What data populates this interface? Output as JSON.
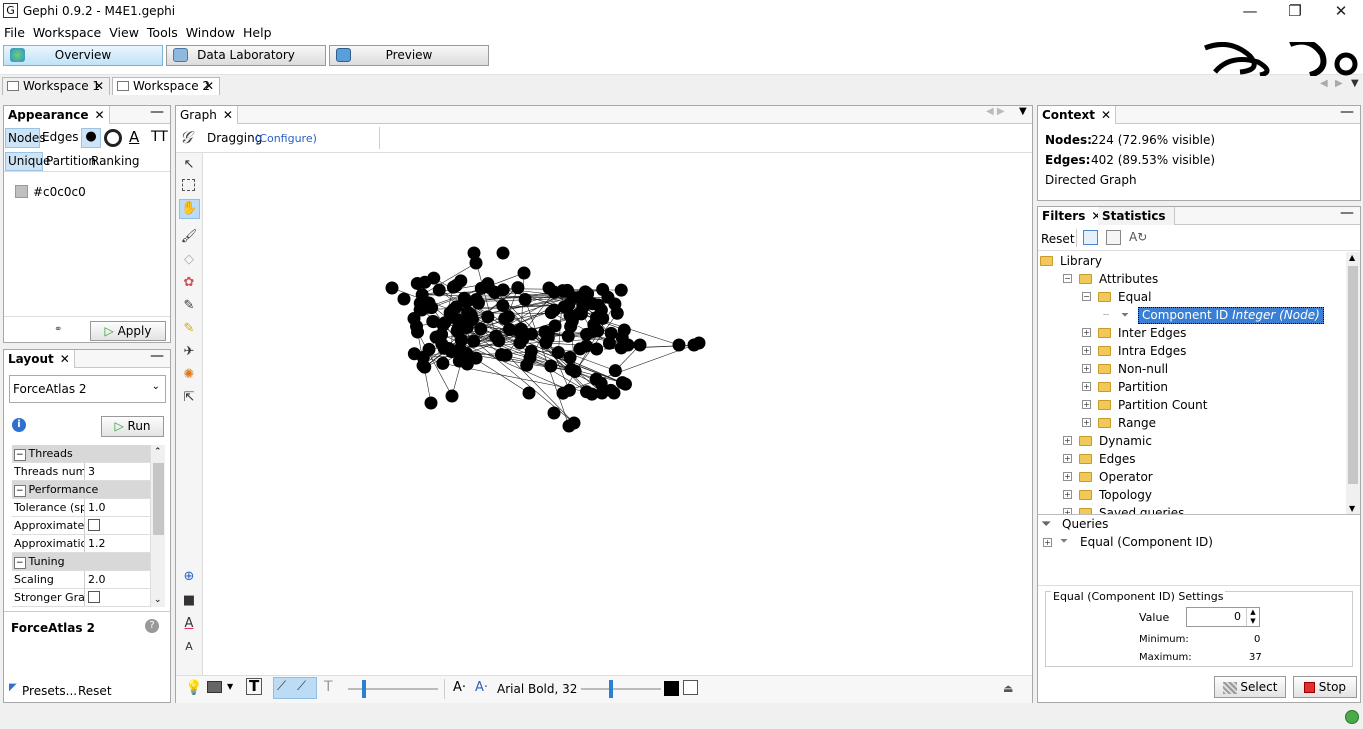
{
  "window": {
    "title": "Gephi 0.9.2 - M4E1.gephi",
    "minimize": "—",
    "maximize": "❐",
    "close": "✕"
  },
  "menu": [
    "File",
    "Workspace",
    "View",
    "Tools",
    "Window",
    "Help"
  ],
  "modes": {
    "overview": "Overview",
    "data_lab": "Data Laboratory",
    "preview": "Preview"
  },
  "workspaces": [
    {
      "label": "Workspace 1"
    },
    {
      "label": "Workspace 2"
    }
  ],
  "appearance": {
    "title": "Appearance",
    "element_tabs": [
      "Nodes",
      "Edges"
    ],
    "mode_tabs": [
      "Unique",
      "Partition",
      "Ranking"
    ],
    "color_value": "#c0c0c0",
    "apply_label": "Apply"
  },
  "layout": {
    "title": "Layout",
    "algorithm": "ForceAtlas 2",
    "run_label": "Run",
    "properties": [
      {
        "cat": "Threads"
      },
      {
        "k": "Threads numb",
        "v": "3"
      },
      {
        "cat": "Performance"
      },
      {
        "k": "Tolerance (spe",
        "v": "1.0"
      },
      {
        "k": "Approximate R",
        "v": "",
        "check": true
      },
      {
        "k": "Approximation",
        "v": "1.2"
      },
      {
        "cat": "Tuning"
      },
      {
        "k": "Scaling",
        "v": "2.0"
      },
      {
        "k": "Stronger Grav",
        "v": "",
        "check": true
      }
    ],
    "desc_title": "ForceAtlas 2",
    "presets": "Presets...",
    "reset": "Reset"
  },
  "graph": {
    "tab": "Graph",
    "mode": "Dragging",
    "configure": "(Configure)",
    "font_label": "Arial Bold, 32"
  },
  "context": {
    "title": "Context",
    "nodes_label": "Nodes:",
    "nodes_value": "224 (72.96% visible)",
    "edges_label": "Edges:",
    "edges_value": "402 (89.53% visible)",
    "graph_type": "Directed Graph"
  },
  "filters": {
    "tab1": "Filters",
    "tab2": "Statistics",
    "reset": "Reset",
    "library": "Library",
    "attributes": "Attributes",
    "equal": "Equal",
    "component_id": "Component ID",
    "component_type": "Integer (Node)",
    "attr_items": [
      "Inter Edges",
      "Intra Edges",
      "Non-null",
      "Partition",
      "Partition Count",
      "Range"
    ],
    "top_items": [
      "Dynamic",
      "Edges",
      "Operator",
      "Topology"
    ],
    "saved_queries": "Saved queries",
    "queries": "Queries",
    "query_item": "Equal (Component ID)",
    "settings_title": "Equal (Component ID) Settings",
    "value_label": "Value",
    "value": "0",
    "min_label": "Minimum:",
    "min_value": "0",
    "max_label": "Maximum:",
    "max_value": "37",
    "select_label": "Select",
    "stop_label": "Stop"
  }
}
